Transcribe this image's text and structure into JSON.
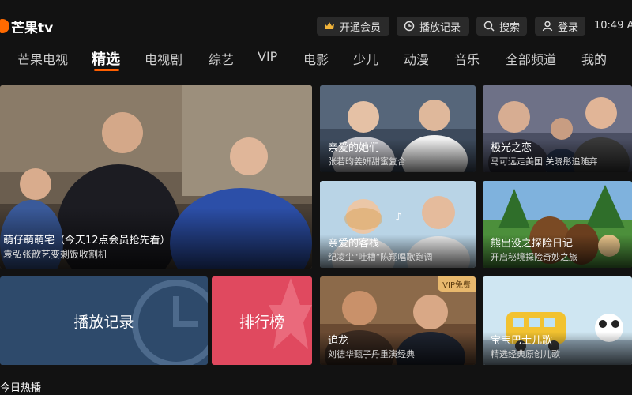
{
  "app": {
    "logo_text": "芒果tv"
  },
  "header": {
    "vip_label": "开通会员",
    "history_label": "播放记录",
    "search_label": "搜索",
    "login_label": "登录",
    "time": "10:49 A"
  },
  "nav": {
    "items": [
      "芒果电视",
      "精选",
      "电视剧",
      "综艺",
      "VIP",
      "电影",
      "少儿",
      "动漫",
      "音乐",
      "全部频道",
      "我的"
    ],
    "active_index": 1
  },
  "featured": {
    "title": "萌仔萌萌宅（今天12点会员抢先看）",
    "subtitle": "袁弘张歆艺变剩饭收割机"
  },
  "cards": [
    {
      "title": "亲爱的她们",
      "subtitle": "张若昀姜妍甜蜜复合"
    },
    {
      "title": "极光之恋",
      "subtitle": "马可远走美国 关晓彤追随弃"
    },
    {
      "title": "亲爱的客栈",
      "subtitle": "纪凌尘“吐槽”陈翔唱歌跑调"
    },
    {
      "title": "熊出没之探险日记",
      "subtitle": "开启秘境探险奇妙之旅"
    },
    {
      "title": "追龙",
      "subtitle": "刘德华甄子丹重演经典",
      "badge": "VIP免费"
    },
    {
      "title": "宝宝巴士儿歌",
      "subtitle": "精选经典原创儿歌"
    }
  ],
  "tiles": {
    "history_label": "播放记录",
    "ranking_label": "排行榜"
  },
  "section": {
    "title": "今日热播"
  },
  "colors": {
    "accent": "#ff5f00",
    "history_tile": "#2e4a6b",
    "ranking_tile": "#e0495f",
    "vip_badge": "#e8b86d"
  }
}
